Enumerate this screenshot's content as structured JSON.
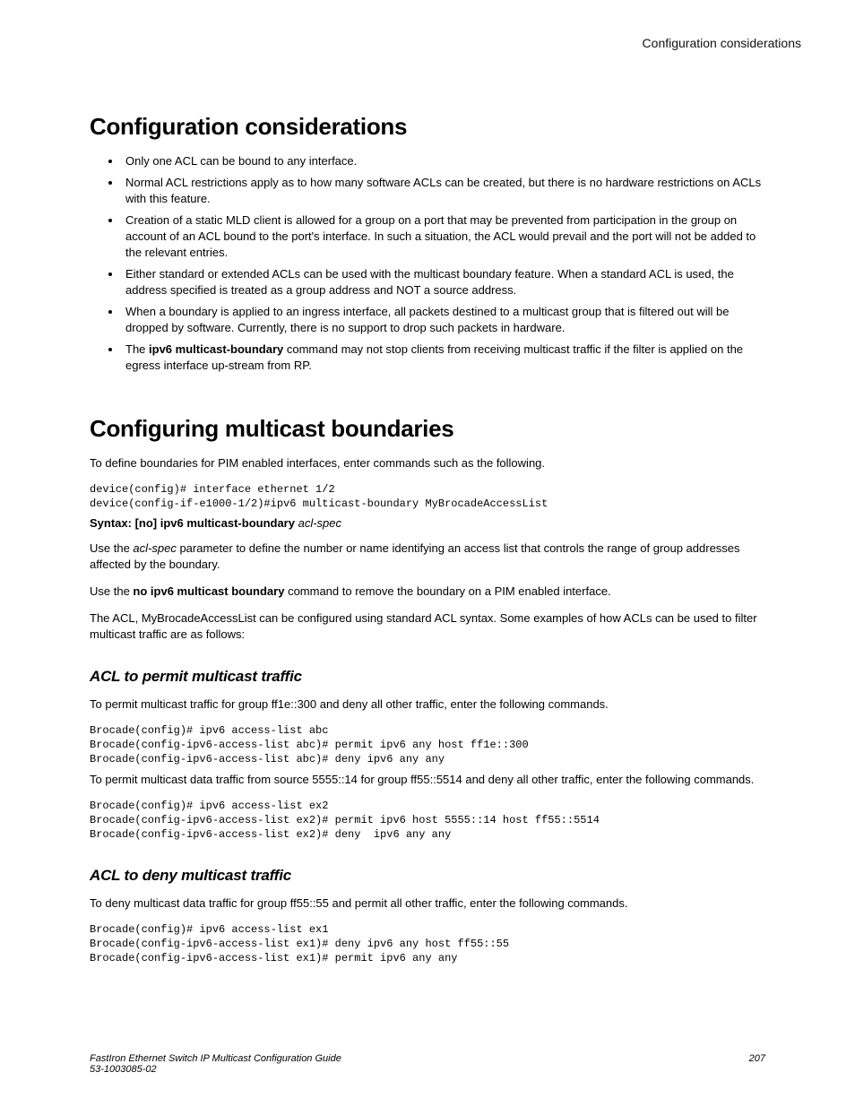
{
  "header": {
    "running_title": "Configuration considerations"
  },
  "section1": {
    "title": "Configuration considerations",
    "bullets": [
      "Only one ACL can be bound to any interface.",
      "Normal ACL restrictions apply as to how many software ACLs can be created, but there is no hardware restrictions on ACLs with this feature.",
      "Creation of a static MLD client is allowed for a group on a port that may be prevented from participation in the group on account of an ACL bound to the port's interface. In such a situation, the ACL would prevail and the port will not be added to the relevant entries.",
      "Either standard or extended ACLs can be used with the multicast boundary feature. When a standard ACL is used, the address specified is treated as a group address and NOT a source address.",
      "When a boundary is applied to an ingress interface, all packets destined to a multicast group that is filtered out will be dropped by software. Currently, there is no support to drop such packets in hardware."
    ],
    "bullet_last": {
      "pre": "The ",
      "bold": "ipv6 multicast-boundary",
      "post": " command may not stop clients from receiving multicast traffic if the filter is applied on the egress interface up-stream from RP."
    }
  },
  "section2": {
    "title": "Configuring multicast boundaries",
    "intro": "To define boundaries for PIM enabled interfaces, enter commands such as the following.",
    "code1": "device(config)# interface ethernet 1/2\ndevice(config-if-e1000-1/2)#ipv6 multicast-boundary MyBrocadeAccessList",
    "syntax": {
      "b1": "Syntax: [no] ipv6 multicast-boundary",
      "i1": "acl-spec"
    },
    "para_aclspec": {
      "pre": "Use the ",
      "ital": "acl-spec",
      "post": " parameter to define the number or name identifying an access list that controls the range of group addresses affected by the boundary."
    },
    "para_noipv6": {
      "pre": "Use the ",
      "bold": "no ipv6 multicast boundary",
      "post": " command to remove the boundary on a PIM enabled interface."
    },
    "para_examples": "The ACL, MyBrocadeAccessList can be configured using standard ACL syntax. Some examples of how ACLs can be used to filter multicast traffic are as follows:"
  },
  "sub1": {
    "title": "ACL to permit multicast traffic",
    "p1": "To permit multicast traffic for group ff1e::300 and deny all other traffic, enter the following commands.",
    "code1": "Brocade(config)# ipv6 access-list abc\nBrocade(config-ipv6-access-list abc)# permit ipv6 any host ff1e::300\nBrocade(config-ipv6-access-list abc)# deny ipv6 any any",
    "p2": "To permit multicast data traffic from source 5555::14 for group ff55::5514 and deny all other traffic, enter the following commands.",
    "code2": "Brocade(config)# ipv6 access-list ex2\nBrocade(config-ipv6-access-list ex2)# permit ipv6 host 5555::14 host ff55::5514\nBrocade(config-ipv6-access-list ex2)# deny  ipv6 any any"
  },
  "sub2": {
    "title": "ACL to deny multicast traffic",
    "p1": "To deny multicast data traffic for group ff55::55 and permit all other traffic, enter the following commands.",
    "code1": "Brocade(config)# ipv6 access-list ex1\nBrocade(config-ipv6-access-list ex1)# deny ipv6 any host ff55::55\nBrocade(config-ipv6-access-list ex1)# permit ipv6 any any"
  },
  "footer": {
    "doc_title": "FastIron Ethernet Switch IP Multicast Configuration Guide",
    "doc_number": "53-1003085-02",
    "page": "207"
  }
}
